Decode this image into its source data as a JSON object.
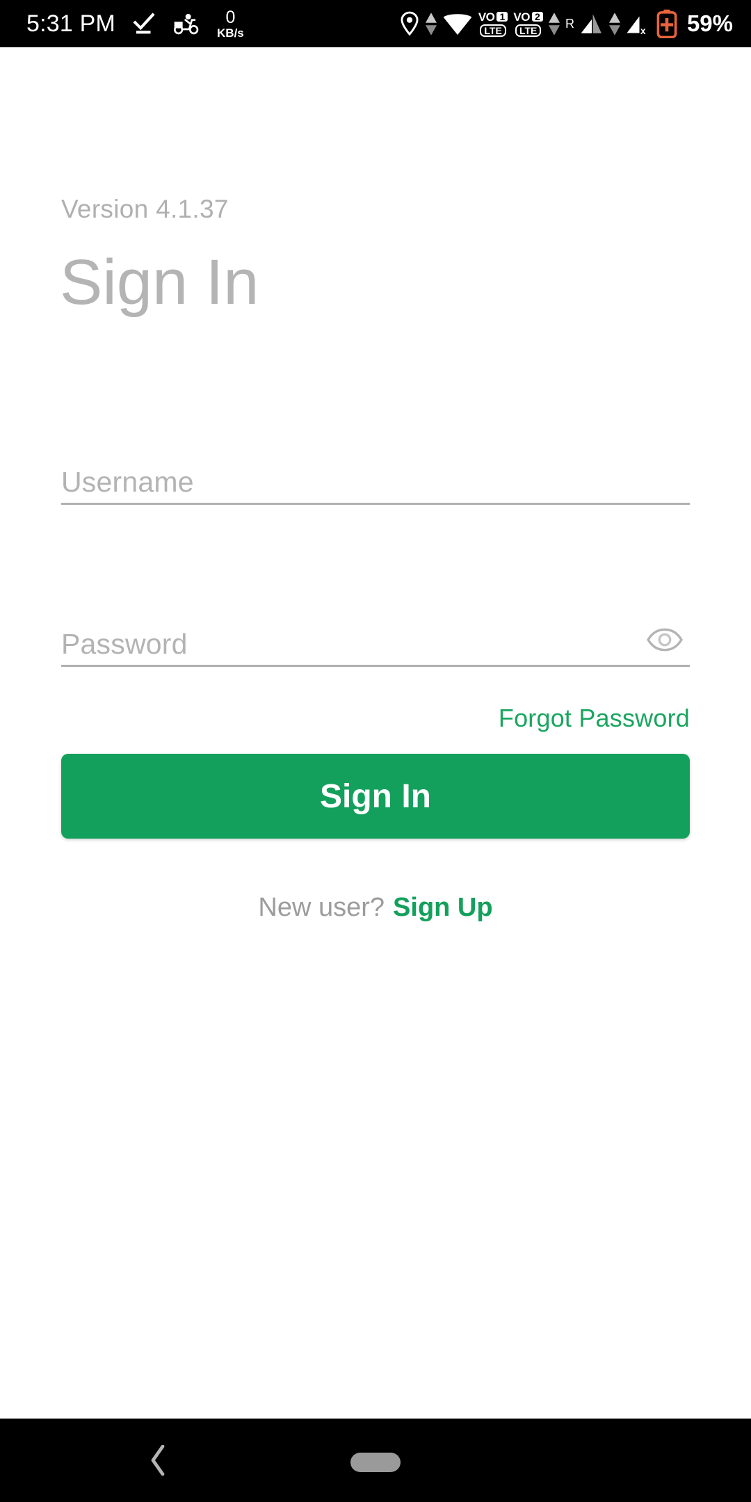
{
  "status_bar": {
    "clock": "5:31 PM",
    "network_speed": {
      "value": "0",
      "unit": "KB/s"
    },
    "icons": [
      "checkmark-underline-icon",
      "scooter-icon",
      "location-pin-icon",
      "wifi-icon",
      "volte-sim1-icon",
      "volte-sim2-icon",
      "signal-sim1-icon",
      "signal-sim2-icon",
      "battery-icon"
    ],
    "sim1": {
      "vo": "VO",
      "slot": "1",
      "tech": "LTE"
    },
    "sim2": {
      "vo": "VO",
      "slot": "2",
      "tech": "LTE"
    },
    "roaming_label": "R",
    "battery_percent": "59%",
    "background_color": "#000000",
    "foreground_color": "#ffffff",
    "battery_color": "#e8643c"
  },
  "screen": {
    "version_label": "Version 4.1.37",
    "title": "Sign In",
    "background_color": "#ffffff"
  },
  "form": {
    "username": {
      "label": "Username",
      "placeholder": "Username",
      "value": ""
    },
    "password": {
      "label": "Password",
      "placeholder": "Password",
      "value": "",
      "toggle_icon": "eye-icon"
    },
    "forgot_password_label": "Forgot Password",
    "submit_label": "Sign In"
  },
  "footer": {
    "signup_prompt": "New user?",
    "signup_link": "Sign Up"
  },
  "nav_bar": {
    "back_icon": "chevron-left-icon",
    "home_icon": "home-pill-icon",
    "background_color": "#000000"
  },
  "colors": {
    "accent_green": "#13a05c",
    "link_green": "#1aa55f",
    "muted_gray": "#b0b0b0",
    "text_gray": "#9c9c9c"
  }
}
